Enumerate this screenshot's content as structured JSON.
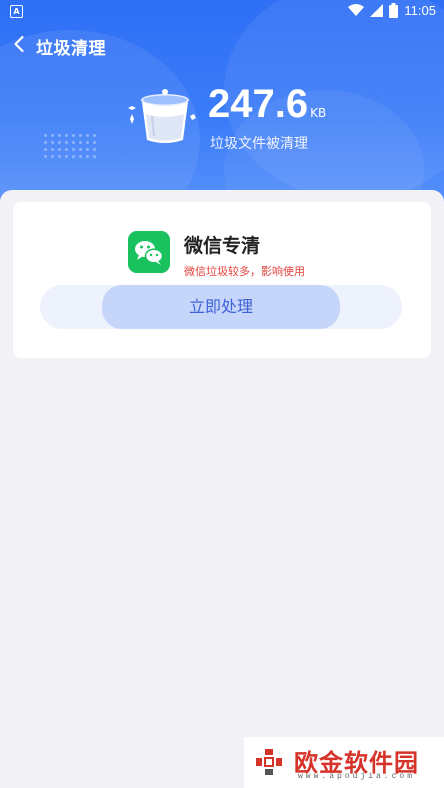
{
  "status_bar": {
    "app_badge": "A",
    "time": "11:05",
    "battery": "8"
  },
  "nav": {
    "title": "垃圾清理"
  },
  "hero": {
    "amount": "247.6",
    "unit": "KB",
    "subtitle": "垃圾文件被清理"
  },
  "card": {
    "title": "微信专清",
    "subtitle": "微信垃圾较多，影响使用",
    "button_label": "立即处理",
    "icon": "wechat-icon"
  },
  "watermark": {
    "text": "欧金软件园",
    "url": "www.apoujia.com"
  },
  "colors": {
    "primary": "#2f6ff5",
    "warning": "#e2413c",
    "button_text": "#3d63d8",
    "wechat_green": "#19c15f"
  }
}
